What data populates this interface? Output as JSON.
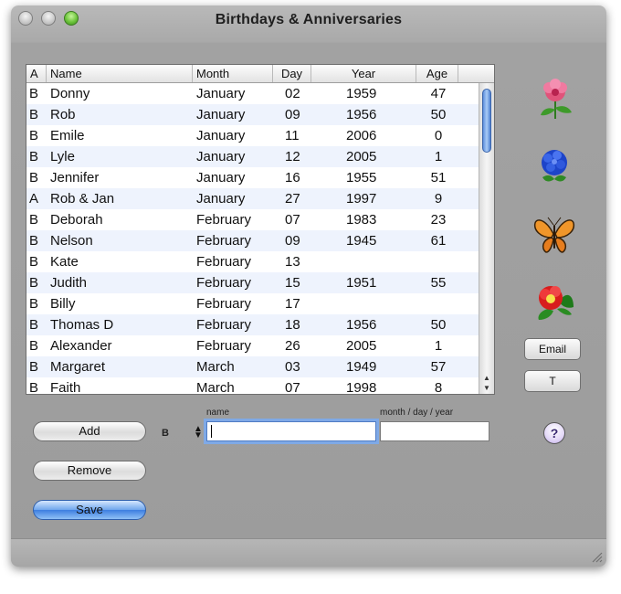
{
  "window": {
    "title": "Birthdays & Anniversaries"
  },
  "table": {
    "columns": [
      "A",
      "Name",
      "Month",
      "Day",
      "Year",
      "Age"
    ],
    "rows": [
      {
        "type": "B",
        "name": "Donny",
        "month": "January",
        "day": "02",
        "year": "1959",
        "age": "47"
      },
      {
        "type": "B",
        "name": "Rob",
        "month": "January",
        "day": "09",
        "year": "1956",
        "age": "50"
      },
      {
        "type": "B",
        "name": "Emile",
        "month": "January",
        "day": "11",
        "year": "2006",
        "age": "0"
      },
      {
        "type": "B",
        "name": "Lyle",
        "month": "January",
        "day": "12",
        "year": "2005",
        "age": "1"
      },
      {
        "type": "B",
        "name": "Jennifer",
        "month": "January",
        "day": "16",
        "year": "1955",
        "age": "51"
      },
      {
        "type": "A",
        "name": "Rob & Jan",
        "month": "January",
        "day": "27",
        "year": "1997",
        "age": "9"
      },
      {
        "type": "B",
        "name": "Deborah",
        "month": "February",
        "day": "07",
        "year": "1983",
        "age": "23"
      },
      {
        "type": "B",
        "name": "Nelson",
        "month": "February",
        "day": "09",
        "year": "1945",
        "age": "61"
      },
      {
        "type": "B",
        "name": "Kate",
        "month": "February",
        "day": "13",
        "year": "",
        "age": ""
      },
      {
        "type": "B",
        "name": "Judith",
        "month": "February",
        "day": "15",
        "year": "1951",
        "age": "55"
      },
      {
        "type": "B",
        "name": "Billy",
        "month": "February",
        "day": "17",
        "year": "",
        "age": ""
      },
      {
        "type": "B",
        "name": "Thomas D",
        "month": "February",
        "day": "18",
        "year": "1956",
        "age": "50"
      },
      {
        "type": "B",
        "name": "Alexander",
        "month": "February",
        "day": "26",
        "year": "2005",
        "age": "1"
      },
      {
        "type": "B",
        "name": "Margaret",
        "month": "March",
        "day": "03",
        "year": "1949",
        "age": "57"
      },
      {
        "type": "B",
        "name": "Faith",
        "month": "March",
        "day": "07",
        "year": "1998",
        "age": "8"
      }
    ]
  },
  "buttons": {
    "add": "Add",
    "remove": "Remove",
    "save": "Save",
    "email": "Email",
    "t": "T",
    "help": "?"
  },
  "form": {
    "type_value": "B",
    "name_label": "name",
    "name_value": "",
    "date_label": "month / day / year",
    "date_value": ""
  },
  "icons": [
    "pink-flower-icon",
    "blue-hydrangea-icon",
    "butterfly-icon",
    "red-camellia-icon"
  ]
}
